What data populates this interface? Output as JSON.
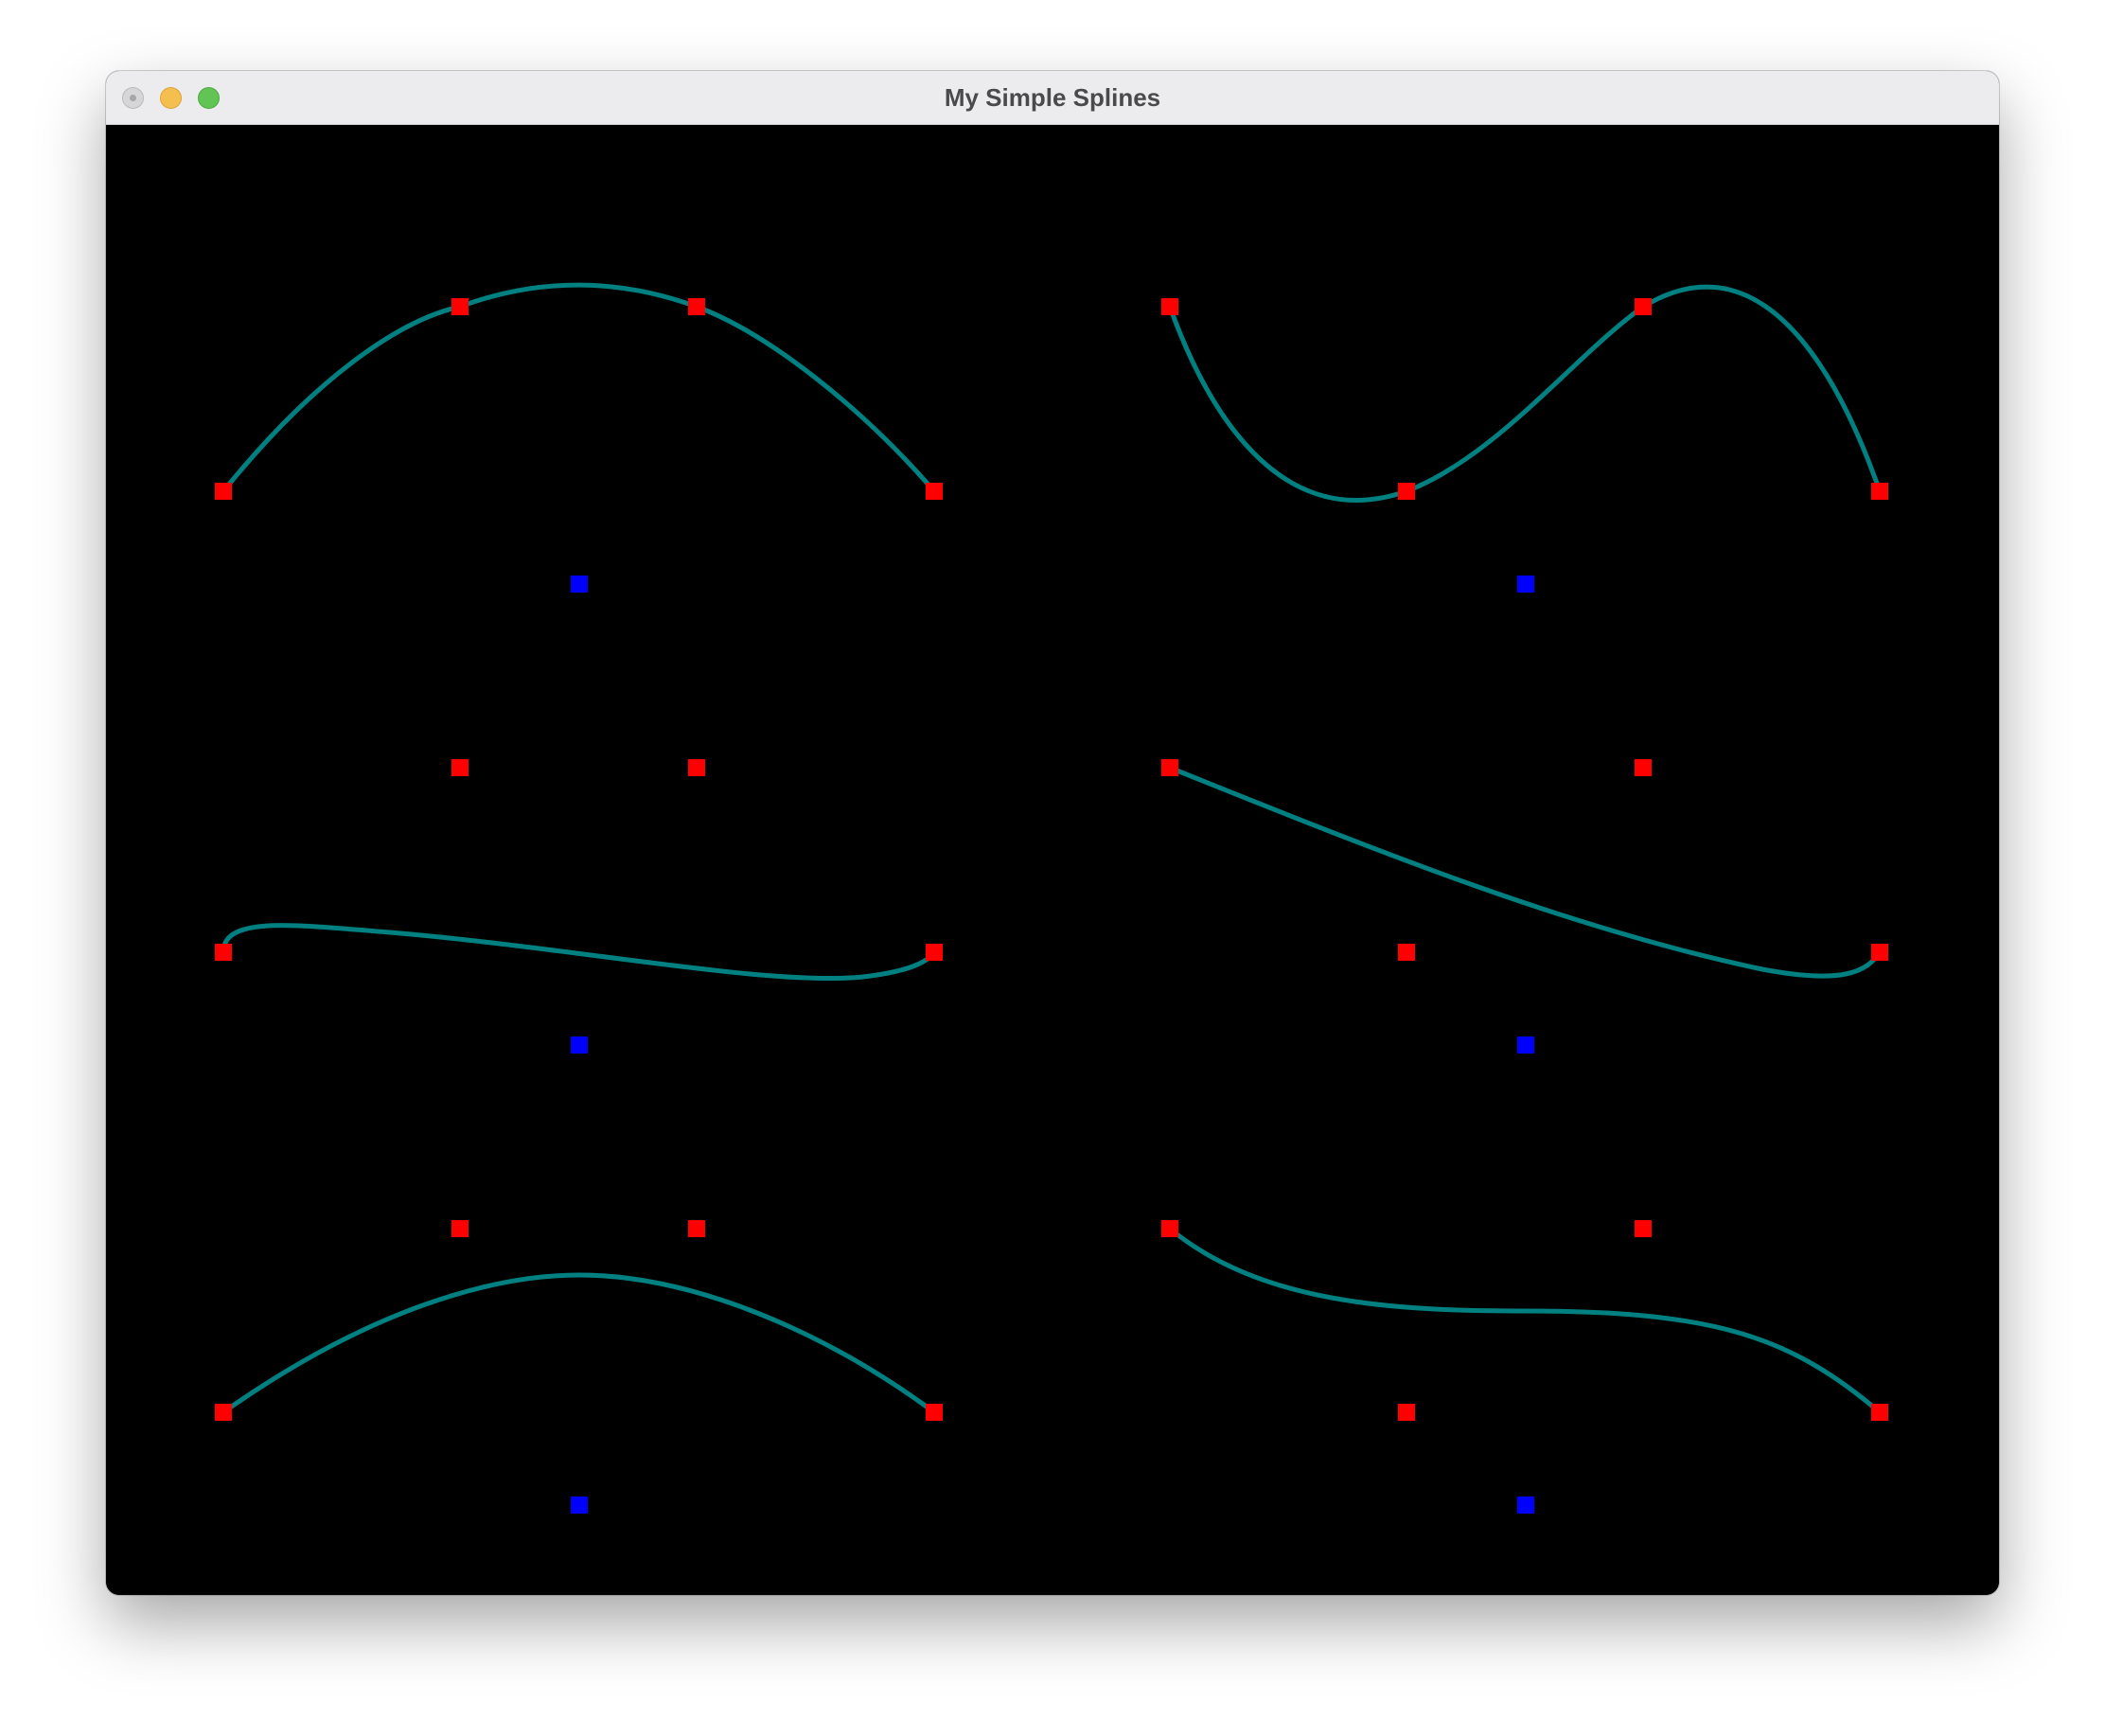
{
  "window": {
    "title": "My Simple Splines",
    "controls": [
      "close",
      "minimize",
      "zoom"
    ]
  },
  "colors": {
    "background": "#000000",
    "curve": "#008080",
    "control_point": "#ff0000",
    "anchor_point": "#0000ff",
    "titlebar": "#ececef"
  },
  "splines": [
    {
      "id": "spline-1",
      "curve": true
    },
    {
      "id": "spline-2",
      "curve": true
    },
    {
      "id": "spline-3",
      "curve": true
    },
    {
      "id": "spline-4",
      "curve": true
    },
    {
      "id": "spline-5",
      "curve": true
    },
    {
      "id": "spline-6",
      "curve": true
    }
  ]
}
